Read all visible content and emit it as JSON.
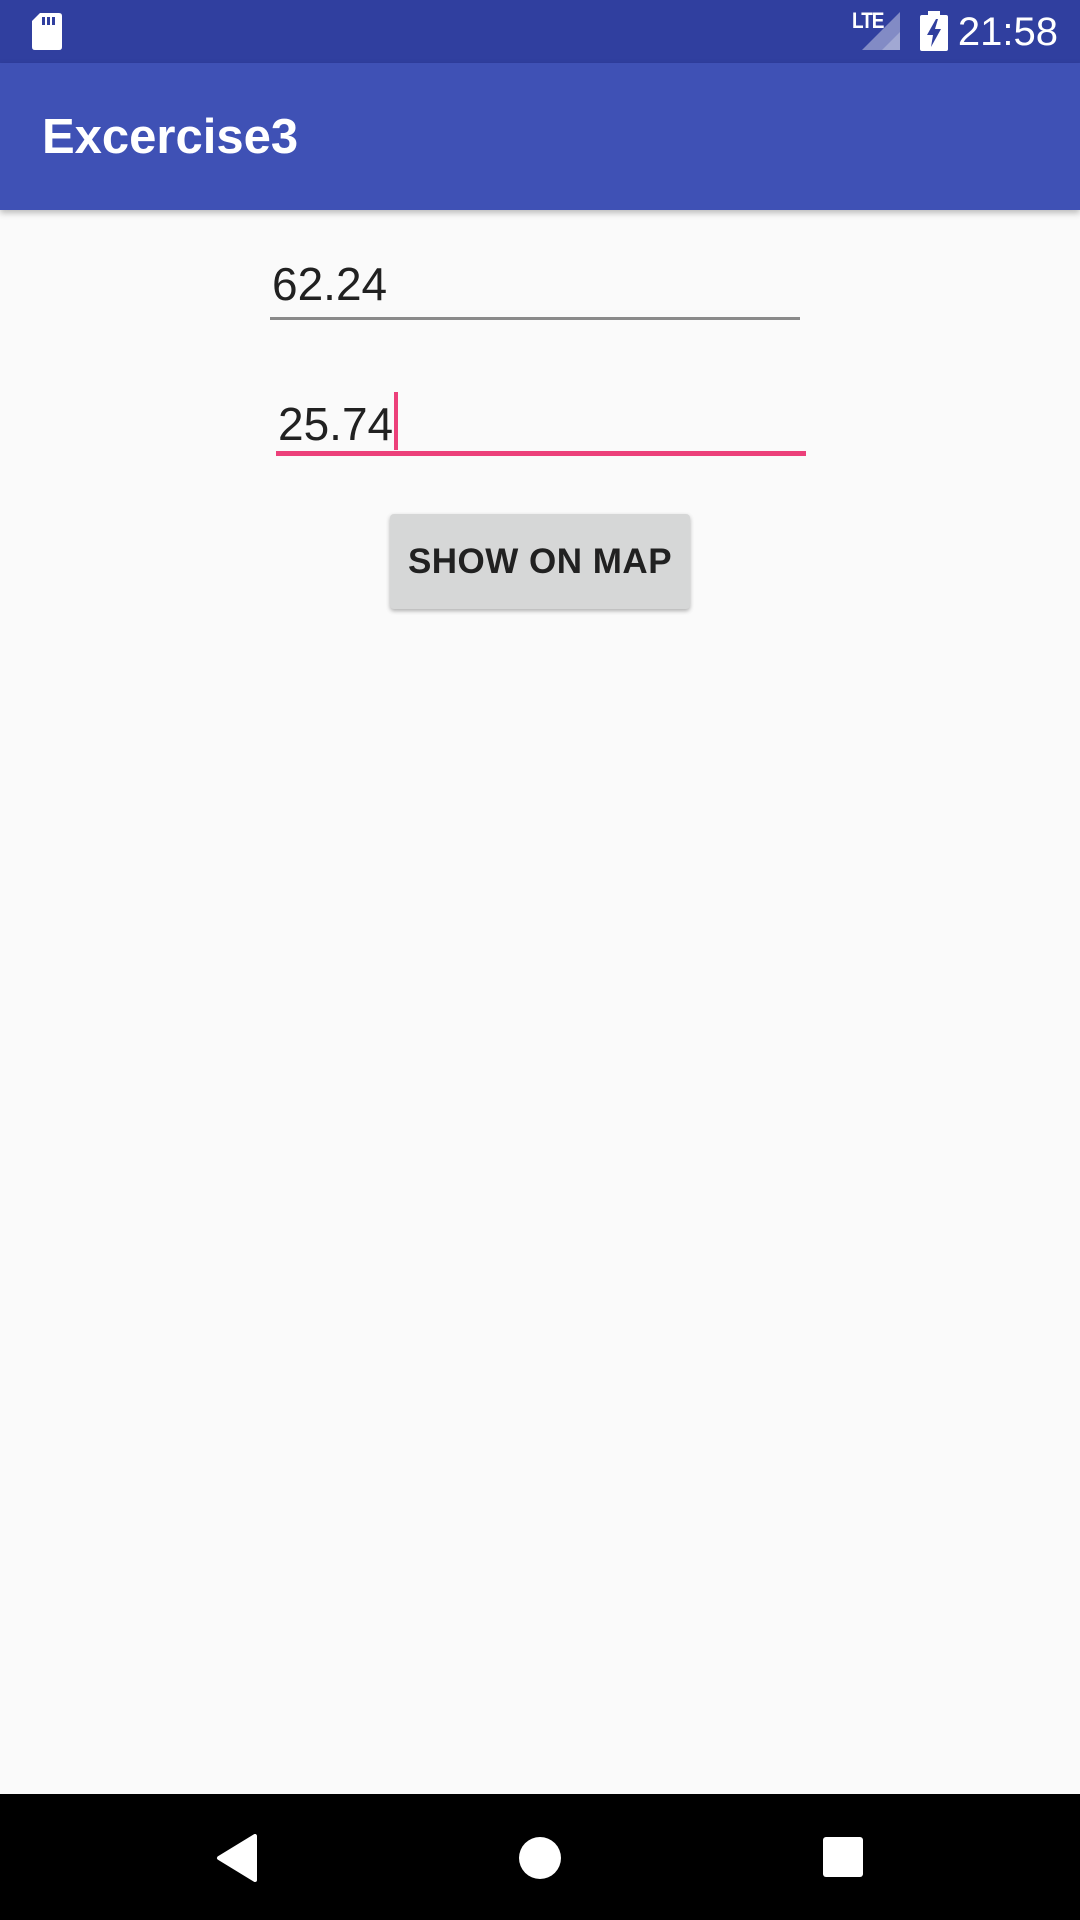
{
  "status_bar": {
    "network_label": "LTE",
    "time": "21:58"
  },
  "app_bar": {
    "title": "Excercise3"
  },
  "form": {
    "latitude_value": "62.24",
    "longitude_value": "25.74",
    "show_button_label": "SHOW ON MAP"
  },
  "colors": {
    "status_bar": "#303f9f",
    "app_bar": "#3f51b5",
    "accent": "#ec407a",
    "button": "#d6d7d7"
  },
  "icons": [
    "sd-card-icon",
    "signal-icon",
    "battery-charging-icon",
    "back-icon",
    "home-icon",
    "recents-icon"
  ]
}
